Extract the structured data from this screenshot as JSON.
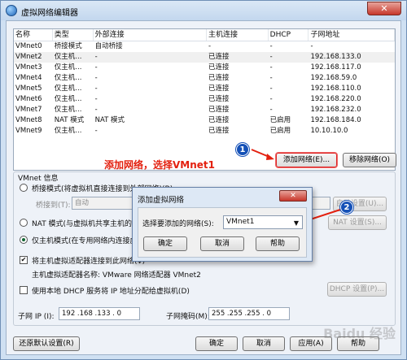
{
  "window": {
    "title": "虚拟网络编辑器",
    "close_glyph": "✕"
  },
  "table": {
    "headers": [
      "名称",
      "类型",
      "外部连接",
      "主机连接",
      "DHCP",
      "子网地址"
    ],
    "rows": [
      [
        "VMnet0",
        "桥接模式",
        "自动桥接",
        "-",
        "-",
        "-"
      ],
      [
        "VMnet2",
        "仅主机...",
        "-",
        "已连接",
        "-",
        "192.168.133.0"
      ],
      [
        "VMnet3",
        "仅主机...",
        "-",
        "已连接",
        "-",
        "192.168.117.0"
      ],
      [
        "VMnet4",
        "仅主机...",
        "-",
        "已连接",
        "-",
        "192.168.59.0"
      ],
      [
        "VMnet5",
        "仅主机...",
        "-",
        "已连接",
        "-",
        "192.168.110.0"
      ],
      [
        "VMnet6",
        "仅主机...",
        "-",
        "已连接",
        "-",
        "192.168.220.0"
      ],
      [
        "VMnet7",
        "仅主机...",
        "-",
        "已连接",
        "-",
        "192.168.232.0"
      ],
      [
        "VMnet8",
        "NAT 模式",
        "NAT 模式",
        "已连接",
        "已启用",
        "192.168.184.0"
      ],
      [
        "VMnet9",
        "仅主机...",
        "-",
        "已连接",
        "已启用",
        "10.10.10.0"
      ]
    ],
    "selected_row": 1
  },
  "buttons": {
    "add_network": "添加网络(E)...",
    "remove_network": "移除网络(O)",
    "auto_settings": "自动设置(U)...",
    "nat_settings": "NAT 设置(S)...",
    "dhcp_settings": "DHCP 设置(P)...",
    "restore_defaults": "还原默认设置(R)",
    "ok": "确定",
    "cancel": "取消",
    "apply": "应用(A)",
    "help": "帮助"
  },
  "annotation": {
    "text": "添加网络，选择VMnet1",
    "badge1": "1",
    "badge2": "2"
  },
  "vmnet_info": {
    "section_label": "VMnet 信息",
    "bridged_label": "桥接模式(将虚拟机直接连接到外部网络)(B)",
    "bridged_to_label": "桥接到(T):",
    "bridged_to_value": "自动",
    "nat_label": "NAT 模式(与虚拟机共享主机的 IP 地址)(N)",
    "hostonly_label": "仅主机模式(在专用网络内连接虚拟机)(H)",
    "connect_adapter_label": "将主机虚拟适配器连接到此网络(V)",
    "adapter_name_label": "主机虚拟适配器名称: VMware 网络适配器 VMnet2",
    "use_dhcp_label": "使用本地 DHCP 服务将 IP 地址分配给虚拟机(D)",
    "subnet_ip_label": "子网 IP (I):",
    "subnet_ip_value": "192 .168 .133 . 0",
    "subnet_mask_label": "子网掩码(M):",
    "subnet_mask_value": "255 .255 .255 . 0"
  },
  "dialog": {
    "title": "添加虚拟网络",
    "close_glyph": "✕",
    "select_label": "选择要添加的网络(S):",
    "select_value": "VMnet1",
    "ok": "确定",
    "cancel": "取消",
    "help": "帮助"
  },
  "watermark": "Baidu 经验",
  "colors": {
    "annotation_red": "#e3200f",
    "badge_blue": "#1551b7"
  }
}
